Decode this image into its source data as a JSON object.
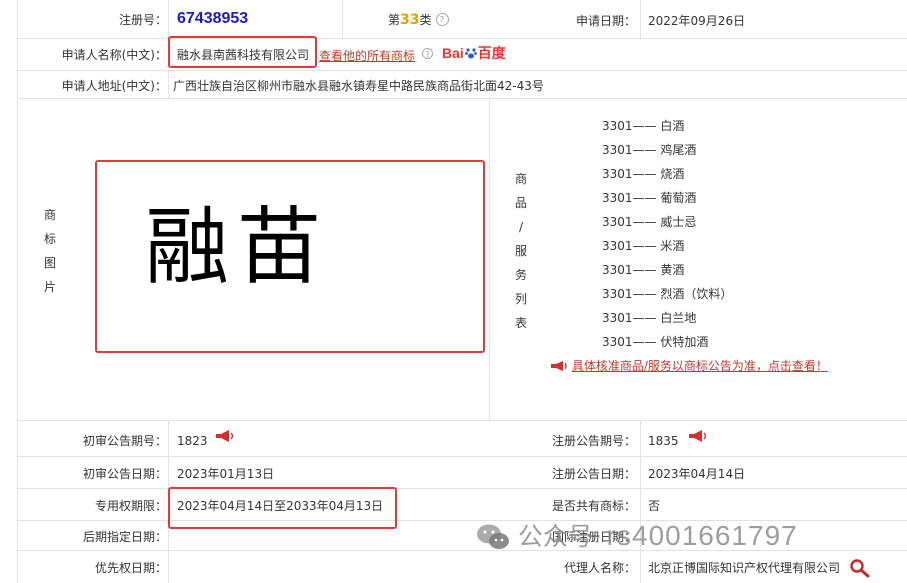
{
  "row1": {
    "reg_label": "注册号：",
    "reg_number": "67438953",
    "class_prefix": "第",
    "class_number": "33",
    "class_suffix": "类",
    "apply_date_label": "申请日期：",
    "apply_date": "2022年09月26日"
  },
  "row2": {
    "applicant_label": "申请人名称(中文)：",
    "applicant": "融水县南茜科技有限公司",
    "view_link": "查看他的所有商标",
    "baidu_bai": "Bai",
    "baidu_du": "百度"
  },
  "row3": {
    "address_label": "申请人地址(中文)：",
    "address": "广西壮族自治区柳州市融水县融水镇寿星中路民族商品街北面42-43号"
  },
  "image_section": {
    "label_chars": [
      "商",
      "标",
      "图",
      "片"
    ],
    "trademark_text": "融苗"
  },
  "goods_section": {
    "label_chars": [
      "商",
      "品",
      "/",
      "服",
      "务",
      "列",
      "表"
    ],
    "items": [
      "3301—— 白酒",
      "3301—— 鸡尾酒",
      "3301—— 烧酒",
      "3301—— 葡萄酒",
      "3301—— 威士忌",
      "3301—— 米酒",
      "3301—— 黄酒",
      "3301—— 烈酒（饮料）",
      "3301—— 白兰地",
      "3301—— 伏特加酒"
    ],
    "notice_link": "具体核准商品/服务以商标公告为准，点击查看！"
  },
  "details": {
    "prelim_no_label": "初审公告期号：",
    "prelim_no": "1823",
    "reg_no_label": "注册公告期号：",
    "reg_no": "1835",
    "prelim_date_label": "初审公告日期：",
    "prelim_date": "2023年01月13日",
    "reg_date_label": "注册公告日期：",
    "reg_date": "2023年04月14日",
    "exclusive_label": "专用权期限：",
    "exclusive": "2023年04月14日至2033年04月13日",
    "shared_label": "是否共有商标：",
    "shared": "否",
    "later_label": "后期指定日期：",
    "intl_label": "国际注册日期：",
    "priority_label": "优先权日期：",
    "agent_label": "代理人名称：",
    "agent": "北京正博国际知识产权代理有限公司"
  },
  "watermark": {
    "wechat": "公众号",
    "id": "rs4001661797"
  },
  "colors": {
    "reg_number": "#1a1acc",
    "class_number": "#e8a000",
    "highlight_box": "#e53935",
    "link": "#c0392b"
  }
}
